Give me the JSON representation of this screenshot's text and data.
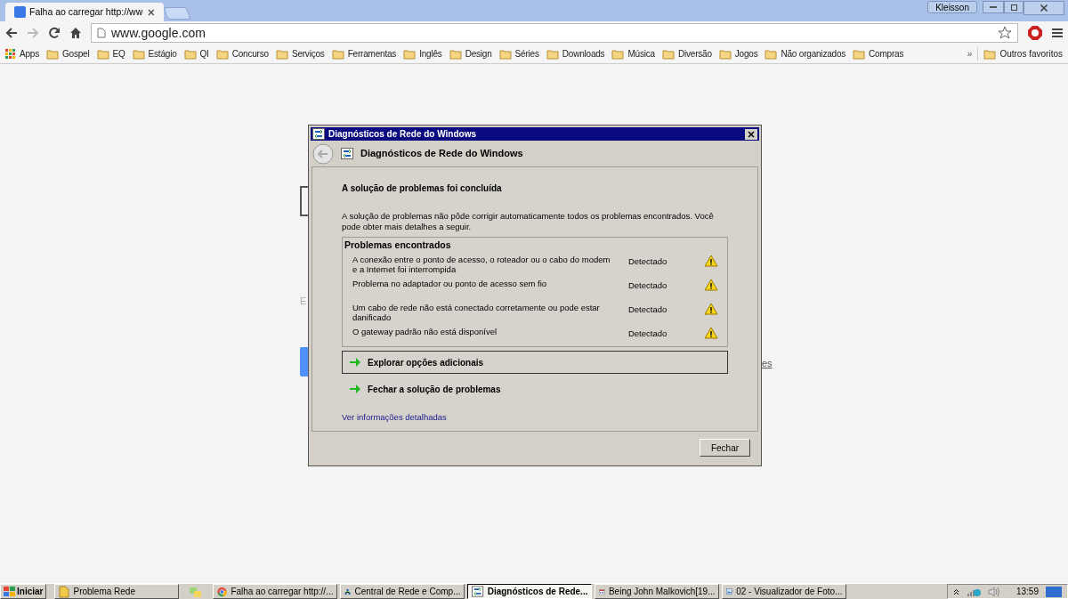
{
  "browser": {
    "tabs": [
      {
        "title": "Falha ao carregar http://ww",
        "selected": true
      }
    ],
    "profile": "Kleisson",
    "address": "www.google.com",
    "bookmarks": [
      {
        "label": "Apps",
        "kind": "apps"
      },
      {
        "label": "Gospel",
        "kind": "folder"
      },
      {
        "label": "EQ",
        "kind": "folder"
      },
      {
        "label": "Estágio",
        "kind": "folder"
      },
      {
        "label": "QI",
        "kind": "folder"
      },
      {
        "label": "Concurso",
        "kind": "folder"
      },
      {
        "label": "Serviços",
        "kind": "folder"
      },
      {
        "label": "Ferramentas",
        "kind": "folder"
      },
      {
        "label": "Inglês",
        "kind": "folder"
      },
      {
        "label": "Design",
        "kind": "folder"
      },
      {
        "label": "Séries",
        "kind": "folder"
      },
      {
        "label": "Downloads",
        "kind": "folder"
      },
      {
        "label": "Música",
        "kind": "folder"
      },
      {
        "label": "Diversão",
        "kind": "folder"
      },
      {
        "label": "Jogos",
        "kind": "folder"
      },
      {
        "label": "Não organizados",
        "kind": "folder"
      },
      {
        "label": "Compras",
        "kind": "folder"
      }
    ],
    "overflow": "»",
    "other_bookmarks": "Outros favoritos"
  },
  "page_fragments": {
    "text": "E",
    "link": "es"
  },
  "dialog": {
    "title": "Diagnósticos de Rede do Windows",
    "header": "Diagnósticos de Rede do Windows",
    "heading": "A solução de problemas foi concluída",
    "description": "A solução de problemas não pôde corrigir automaticamente todos os problemas encontrados. Você pode obter mais detalhes a seguir.",
    "problems_title": "Problemas encontrados",
    "problems": [
      {
        "text": "A conexão entre o ponto de acesso, o roteador ou o cabo do modem e a Internet foi interrompida",
        "status": "Detectado"
      },
      {
        "text": "Problema no adaptador ou ponto de acesso sem fio",
        "status": "Detectado"
      },
      {
        "text": "Um cabo de rede não está conectado corretamente ou pode estar danificado",
        "status": "Detectado"
      },
      {
        "text": "O gateway padrão não está disponível",
        "status": "Detectado"
      }
    ],
    "actions": [
      {
        "label": "Explorar opções adicionais",
        "selected": true
      },
      {
        "label": "Fechar a solução de problemas",
        "selected": false
      }
    ],
    "details_link": "Ver informações detalhadas",
    "close_button": "Fechar"
  },
  "taskbar": {
    "start": "Iniciar",
    "items": [
      {
        "label": "Problema Rede",
        "kind": "folder",
        "selected": false
      },
      {
        "label": "Falha ao carregar http://...",
        "kind": "chrome",
        "selected": false
      },
      {
        "label": "Central de Rede e Comp...",
        "kind": "network",
        "selected": false
      },
      {
        "label": "Diagnósticos de Rede...",
        "kind": "diag",
        "selected": true
      },
      {
        "label": "Being John Malkovich[19...",
        "kind": "calendar",
        "selected": false
      },
      {
        "label": "02 - Visualizador de Foto...",
        "kind": "photo",
        "selected": false
      }
    ],
    "clock": "13:59"
  }
}
